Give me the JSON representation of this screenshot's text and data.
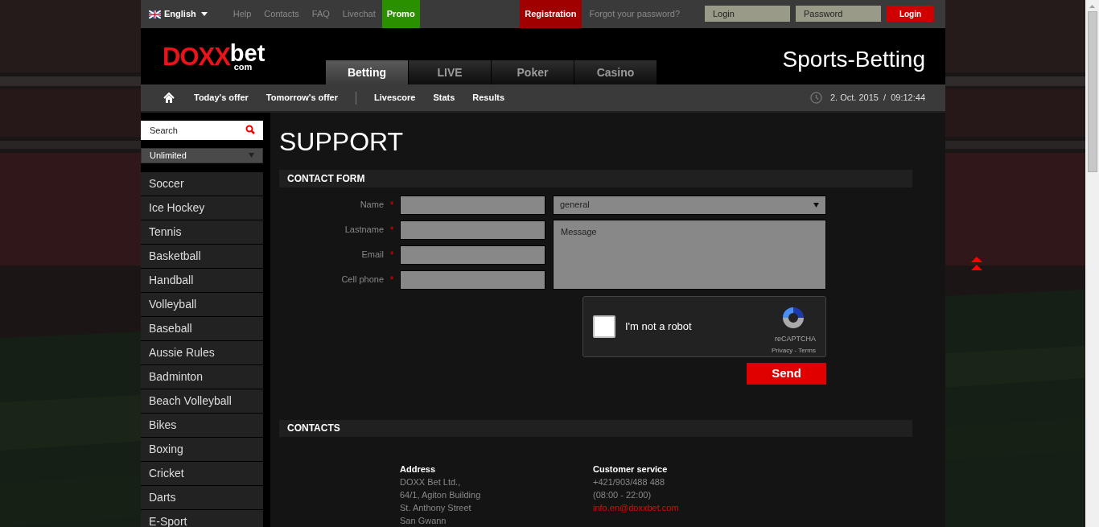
{
  "top_bar": {
    "language": "English",
    "links": [
      {
        "label": "Help",
        "kind": "plain"
      },
      {
        "label": "Contacts",
        "kind": "plain"
      },
      {
        "label": "FAQ",
        "kind": "plain"
      },
      {
        "label": "Livechat",
        "kind": "plain"
      },
      {
        "label": "Promo",
        "kind": "promo"
      }
    ],
    "registration": "Registration",
    "forgot_password": "Forgot your password?",
    "login_placeholder": "Login",
    "password_placeholder": "Password",
    "login_button": "Login"
  },
  "header": {
    "logo": {
      "main": "DOXX",
      "suffix": "bet",
      "domain": "com"
    },
    "title": "Sports-Betting",
    "tabs": [
      {
        "label": "Betting",
        "selected": true
      },
      {
        "label": "LIVE",
        "selected": false
      },
      {
        "label": "Poker",
        "selected": false
      },
      {
        "label": "Casino",
        "selected": false
      }
    ]
  },
  "sub_nav": {
    "links": [
      {
        "label": "Today's offer",
        "kind": "link"
      },
      {
        "label": "Tomorrow's offer",
        "kind": "link"
      },
      {
        "kind": "separator"
      },
      {
        "label": "Livescore",
        "kind": "link"
      },
      {
        "label": "Stats",
        "kind": "link"
      },
      {
        "label": "Results",
        "kind": "link"
      }
    ],
    "date": "2. Oct. 2015",
    "date_separator": "/",
    "time": "09:12:44"
  },
  "sidebar": {
    "search_placeholder": "Search",
    "filter": "Unlimited",
    "items": [
      "Soccer",
      "Ice Hockey",
      "Tennis",
      "Basketball",
      "Handball",
      "Volleyball",
      "Baseball",
      "Aussie Rules",
      "Badminton",
      "Beach Volleyball",
      "Bikes",
      "Boxing",
      "Cricket",
      "Darts",
      "E-Sport"
    ]
  },
  "main": {
    "title": "SUPPORT",
    "contact_form": {
      "heading": "CONTACT FORM",
      "fields": [
        {
          "label": "Name",
          "required_mark": "*"
        },
        {
          "label": "Lastname",
          "required_mark": "*"
        },
        {
          "label": "Email",
          "required_mark": "*"
        },
        {
          "label": "Cell phone",
          "required_mark": "*"
        }
      ],
      "topic": "general",
      "message_placeholder": "Message",
      "captcha": {
        "label": "I'm not a robot",
        "checked": false,
        "brand": "reCAPTCHA",
        "links": "Privacy - Terms"
      },
      "send": "Send"
    },
    "contacts": {
      "heading": "CONTACTS",
      "columns": [
        {
          "title": "Address",
          "lines": [
            {
              "text": "DOXX Bet Ltd.,",
              "kind": "plain"
            },
            {
              "text": "64/1, Agiton Building",
              "kind": "plain"
            },
            {
              "text": "St. Anthony Street",
              "kind": "plain"
            },
            {
              "text": "San Gwann",
              "kind": "plain"
            }
          ]
        },
        {
          "title": "Customer service",
          "lines": [
            {
              "text": "+421/903/488 488",
              "kind": "plain"
            },
            {
              "text": "(08:00 - 22:00)",
              "kind": "plain"
            },
            {
              "text": "info.en@doxxbet.com",
              "kind": "email"
            }
          ]
        }
      ]
    }
  }
}
